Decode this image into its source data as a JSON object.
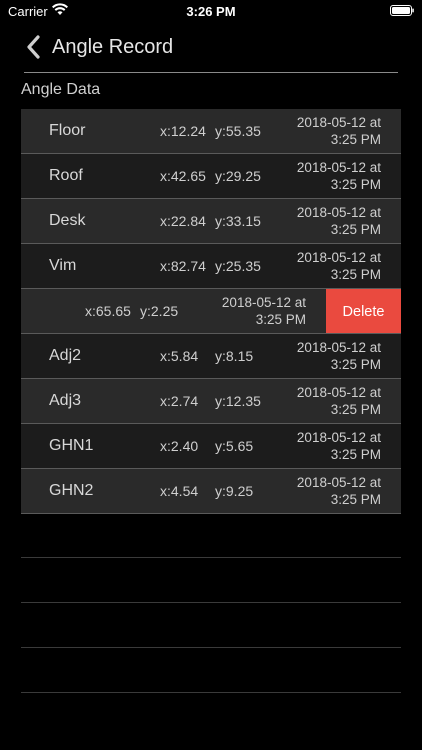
{
  "status_bar": {
    "carrier": "Carrier",
    "time": "3:26 PM"
  },
  "nav": {
    "back_icon": "chevron-left-icon",
    "title": "Angle Record"
  },
  "section": {
    "header": "Angle Data"
  },
  "records": [
    {
      "name": "Floor",
      "x": "x:12.24",
      "y": "y:55.35",
      "date": "2018-05-12 at",
      "time": "3:25 PM"
    },
    {
      "name": "Roof",
      "x": "x:42.65",
      "y": "y:29.25",
      "date": "2018-05-12 at",
      "time": "3:25 PM"
    },
    {
      "name": "Desk",
      "x": "x:22.84",
      "y": "y:33.15",
      "date": "2018-05-12 at",
      "time": "3:25 PM"
    },
    {
      "name": "Vim",
      "x": "x:82.74",
      "y": "y:25.35",
      "date": "2018-05-12 at",
      "time": "3:25 PM"
    },
    {
      "name": "",
      "x": "x:65.65",
      "y": "y:2.25",
      "date": "2018-05-12 at",
      "time": "3:25 PM",
      "action": "Delete"
    },
    {
      "name": "Adj2",
      "x": "x:5.84",
      "y": "y:8.15",
      "date": "2018-05-12 at",
      "time": "3:25 PM"
    },
    {
      "name": "Adj3",
      "x": "x:2.74",
      "y": "y:12.35",
      "date": "2018-05-12 at",
      "time": "3:25 PM"
    },
    {
      "name": "GHN1",
      "x": "x:2.40",
      "y": "y:5.65",
      "date": "2018-05-12 at",
      "time": "3:25 PM"
    },
    {
      "name": "GHN2",
      "x": "x:4.54",
      "y": "y:9.25",
      "date": "2018-05-12 at",
      "time": "3:25 PM"
    }
  ],
  "colors": {
    "background": "#000000",
    "delete": "#ea4a3f"
  }
}
